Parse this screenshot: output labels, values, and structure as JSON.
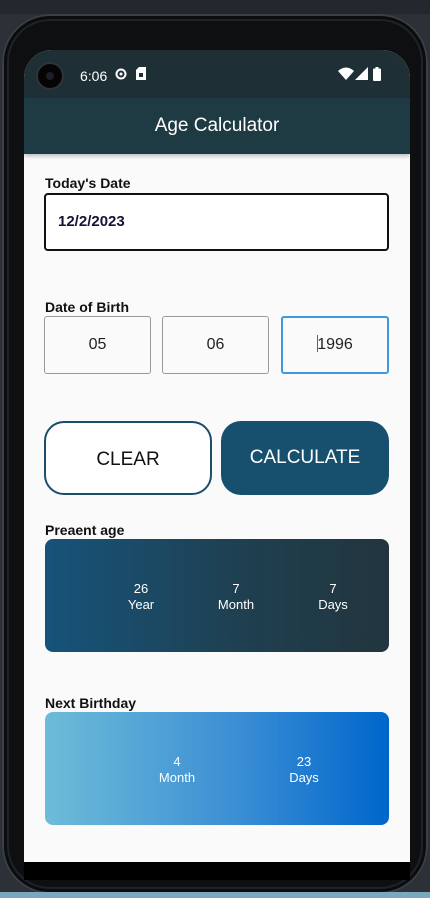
{
  "status_bar": {
    "time": "6:06",
    "icons": [
      "settings-icon",
      "sim-card-icon",
      "wifi-icon",
      "signal-icon",
      "battery-icon"
    ]
  },
  "app_bar": {
    "title": "Age Calculator"
  },
  "today": {
    "label": "Today's Date",
    "value": "12/2/2023"
  },
  "dob": {
    "label": "Date of Birth",
    "day": "05",
    "month": "06",
    "year": "1996"
  },
  "buttons": {
    "clear": "CLEAR",
    "calculate": "CALCULATE"
  },
  "present_age": {
    "label": "Preaent age",
    "years": "26",
    "years_unit": "Year",
    "months": "7",
    "months_unit": "Month",
    "days": "7",
    "days_unit": "Days"
  },
  "next_birthday": {
    "label": "Next Birthday",
    "months": "4",
    "months_unit": "Month",
    "days": "23",
    "days_unit": "Days"
  },
  "colors": {
    "app_bar": "#1e3a43",
    "calculate_button": "#17506f",
    "age_card_start": "#16537a",
    "age_card_end": "#22353f",
    "next_card_start": "#6dbcd8",
    "next_card_end": "#0066cc",
    "active_field": "#3a9be0"
  }
}
